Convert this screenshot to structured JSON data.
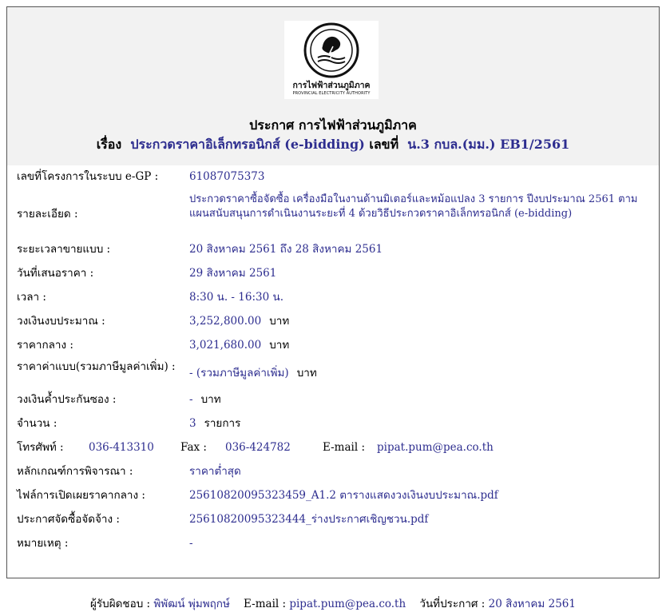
{
  "header": {
    "logo_th": "การไฟฟ้าส่วนภูมิภาค",
    "logo_en": "PROVINCIAL ELECTRICITY AUTHORITY",
    "title": "ประกาศ การไฟฟ้าส่วนภูมิภาค",
    "subject_label": "เรื่อง",
    "subject": "ประกวดราคาอิเล็กทรอนิกส์ (e-bidding)",
    "number_label": "เลขที่",
    "number": "น.3 กบล.(มม.) EB1/2561"
  },
  "details": {
    "project_no": {
      "label": "เลขที่โครงการในระบบ e-GP :",
      "value": "61087075373"
    },
    "description": {
      "label": "รายละเอียด :",
      "value": "ประกวดราคาซื้อจัดซื้อ เครื่องมือในงานด้านมิเตอร์และหม้อแปลง 3 รายการ ปีงบประมาณ 2561 ตามแผนสนับสนุนการดำเนินงานระยะที่ 4 ด้วยวิธีประกวดราคาอิเล็กทรอนิกส์ (e-bidding)"
    },
    "sale_period": {
      "label": "ระยะเวลาขายแบบ :",
      "value": "20 สิงหาคม 2561 ถึง 28 สิงหาคม 2561"
    },
    "bid_date": {
      "label": "วันที่เสนอราคา :",
      "value": "29 สิงหาคม 2561"
    },
    "time": {
      "label": "เวลา :",
      "value": "8:30 น. - 16:30 น."
    },
    "budget": {
      "label": "วงเงินงบประมาณ :",
      "value": "3,252,800.00",
      "unit": "บาท"
    },
    "median_price": {
      "label": "ราคากลาง :",
      "value": "3,021,680.00",
      "unit": "บาท"
    },
    "doc_price": {
      "label": "ราคาค่าแบบ(รวมภาษีมูลค่าเพิ่ม) :",
      "value": "- (รวมภาษีมูลค่าเพิ่ม)",
      "unit": "บาท"
    },
    "guarantee": {
      "label": "วงเงินค้ำประกันซอง :",
      "value": "-",
      "unit": "บาท"
    },
    "quantity": {
      "label": "จำนวน :",
      "value": "3",
      "unit": "รายการ"
    },
    "phone": {
      "label": "โทรศัพท์ :",
      "value": "036-413310",
      "fax_label": "Fax :",
      "fax": "036-424782",
      "email_label": "E-mail :",
      "email": "pipat.pum@pea.co.th"
    },
    "criteria": {
      "label": "หลักเกณฑ์การพิจารณา :",
      "value": "ราคาต่ำสุด"
    },
    "disclosure_file": {
      "label": "ไฟล์การเปิดเผยราคากลาง :",
      "value": "25610820095323459_A1.2 ตารางแสดงวงเงินงบประมาณ.pdf"
    },
    "announcement_file": {
      "label": "ประกาศจัดซื้อจัดจ้าง :",
      "value": "25610820095323444_ร่างประกาศเชิญชวน.pdf"
    },
    "remark": {
      "label": "หมายเหตุ :",
      "value": "-"
    }
  },
  "footer": {
    "responsible_label": "ผู้รับผิดชอบ :",
    "responsible": "พิพัฒน์ พุ่มพฤกษ์",
    "email_label": "E-mail :",
    "email": "pipat.pum@pea.co.th",
    "date_label": "วันที่ประกาศ :",
    "date": "20 สิงหาคม 2561"
  },
  "colors": {
    "link": "#2d2d8f",
    "header_bg": "#f2f2f2"
  }
}
